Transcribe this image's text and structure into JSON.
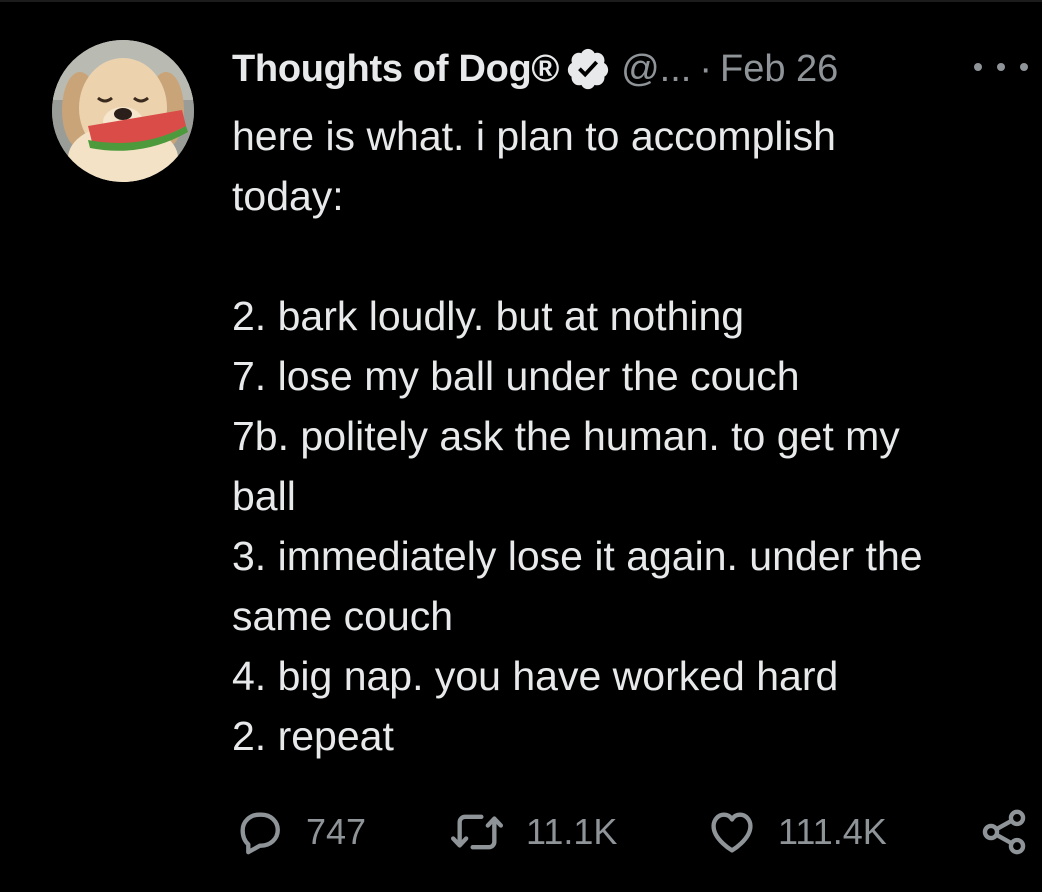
{
  "tweet": {
    "author_name": "Thoughts of Dog®",
    "handle": "@...",
    "separator": "·",
    "date": "Feb 26",
    "verified": true,
    "lines": [
      "here is what. i plan to accomplish",
      "today:",
      "",
      "2. bark loudly. but at nothing",
      "7. lose my ball under the couch",
      "7b. politely ask the human. to get my",
      "ball",
      "3. immediately lose it again. under the",
      "same couch",
      "4. big nap. you have worked hard",
      "2. repeat"
    ]
  },
  "actions": {
    "replies": "747",
    "retweets": "11.1K",
    "likes": "111.4K"
  },
  "icons": {
    "reply": "reply-icon",
    "retweet": "retweet-icon",
    "like": "heart-icon",
    "share": "share-icon",
    "more": "more-options-icon",
    "verified": "verified-badge-icon"
  },
  "colors": {
    "background": "#000000",
    "text_primary": "#e7e9ea",
    "text_secondary": "#8f9499"
  }
}
